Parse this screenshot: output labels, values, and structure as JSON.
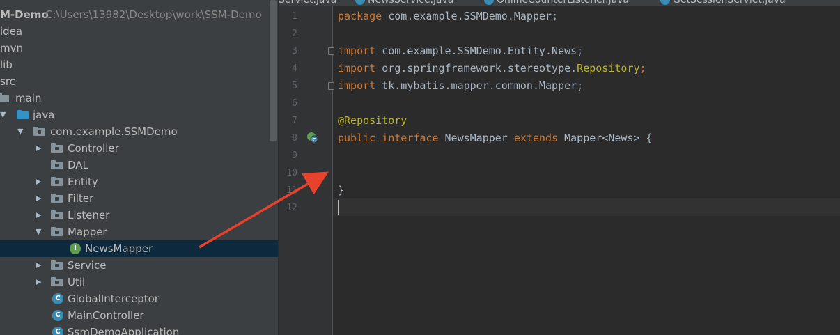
{
  "project": {
    "root_name": "M-Demo",
    "root_path": "C:\\Users\\13982\\Desktop\\work\\SSM-Demo",
    "items": [
      {
        "label": "idea"
      },
      {
        "label": "mvn"
      },
      {
        "label": "lib"
      },
      {
        "label": "src"
      },
      {
        "label": "main"
      },
      {
        "label": "java"
      },
      {
        "label": "com.example.SSMDemo"
      },
      {
        "label": "Controller"
      },
      {
        "label": "DAL"
      },
      {
        "label": "Entity"
      },
      {
        "label": "Filter"
      },
      {
        "label": "Listener"
      },
      {
        "label": "Mapper"
      },
      {
        "label": "NewsMapper"
      },
      {
        "label": "Service"
      },
      {
        "label": "Util"
      },
      {
        "label": "GlobalInterceptor"
      },
      {
        "label": "MainController"
      },
      {
        "label": "SsmDemoApplication"
      }
    ]
  },
  "tabs": [
    {
      "label": "Servlet.java"
    },
    {
      "label": "NewsService.java"
    },
    {
      "label": "OnlineCounterListener.java"
    },
    {
      "label": "GetSessionServlet.java"
    }
  ],
  "editor": {
    "line_numbers": [
      "1",
      "2",
      "3",
      "4",
      "5",
      "6",
      "7",
      "8",
      "9",
      "10",
      "11",
      "12"
    ],
    "lines": {
      "l1_kw": "package",
      "l1_rest": " com.example.SSMDemo.Mapper;",
      "l3_kw": "import",
      "l3_rest": " com.example.SSMDemo.Entity.News;",
      "l4_kw": "import",
      "l4_pkg": " org.springframework.stereotype.",
      "l4_cls": "Repository",
      "l4_end": ";",
      "l5_kw": "import",
      "l5_rest": " tk.mybatis.mapper.common.Mapper;",
      "l7_ann": "@Repository",
      "l8_kw1": "public",
      "l8_kw2": " interface",
      "l8_name": " NewsMapper",
      "l8_kw3": " extends",
      "l8_rest": " Mapper<News> {",
      "l11": "}"
    }
  },
  "colors": {
    "keyword": "#cc7832",
    "annotation": "#bbb529",
    "text": "#a9b7c6",
    "arrow": "#e8412c"
  }
}
